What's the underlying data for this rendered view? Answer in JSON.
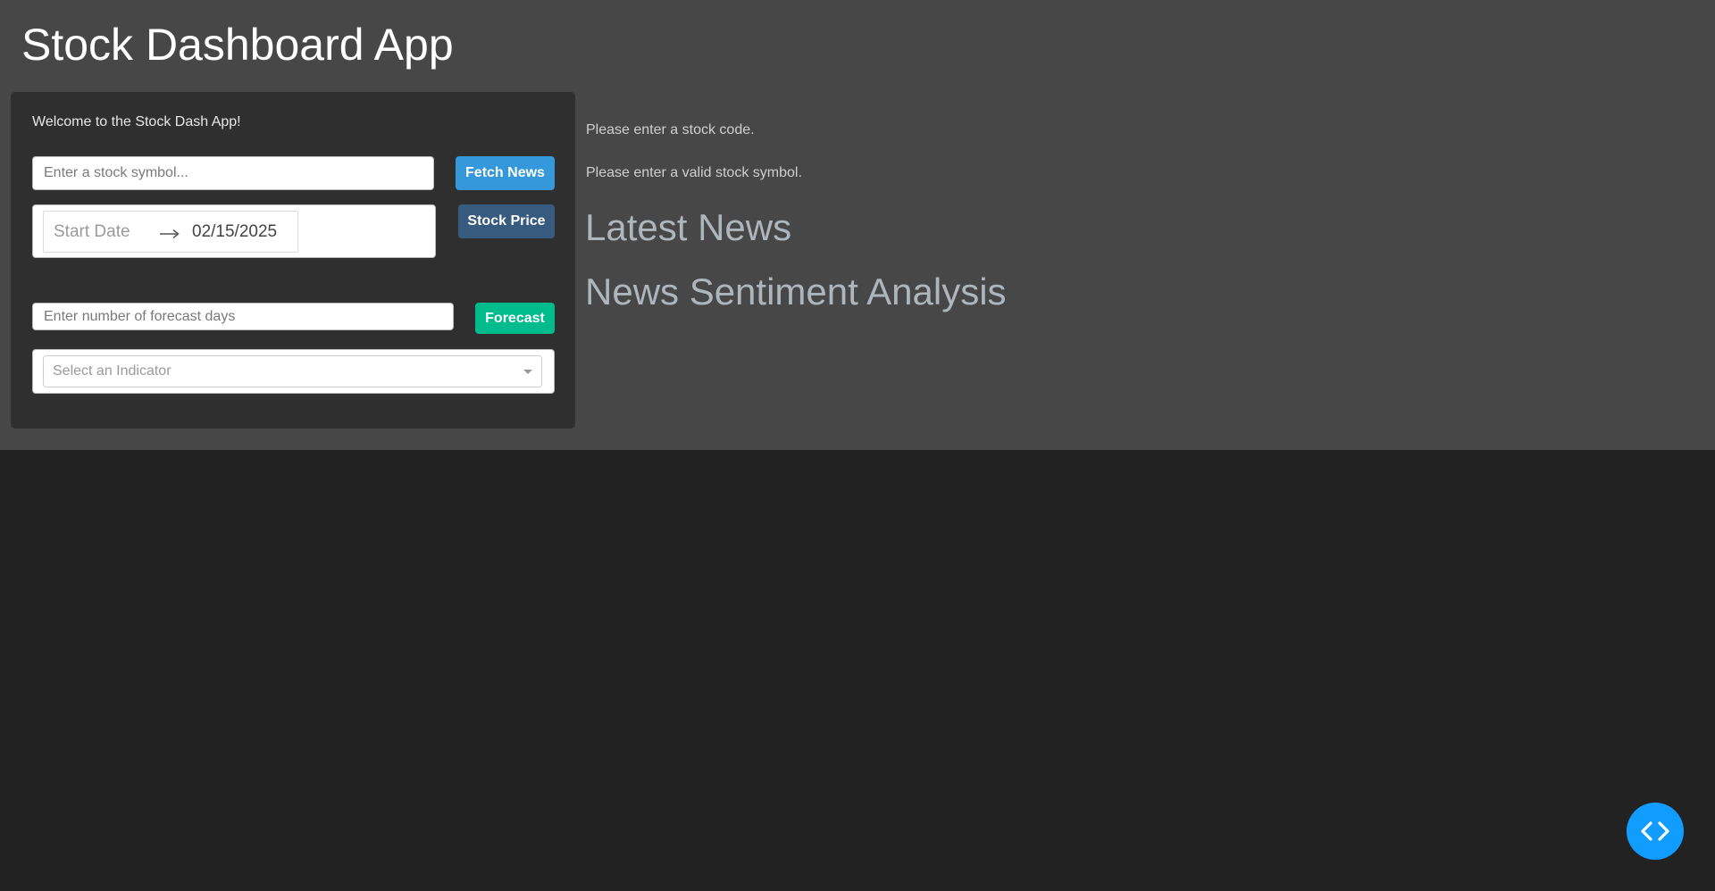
{
  "app": {
    "title": "Stock Dashboard App"
  },
  "panel": {
    "welcome": "Welcome to the Stock Dash App!",
    "symbol_input": {
      "placeholder": "Enter a stock symbol...",
      "value": ""
    },
    "fetch_news_label": "Fetch News",
    "date_range": {
      "start_placeholder": "Start Date",
      "end_value": "02/15/2025"
    },
    "stock_price_label": "Stock Price",
    "forecast_input": {
      "placeholder": "Enter number of forecast days",
      "value": ""
    },
    "forecast_label": "Forecast",
    "indicator_select": {
      "placeholder": "Select an Indicator"
    }
  },
  "main": {
    "messages": [
      "Please enter a stock code.",
      "Please enter a valid stock symbol."
    ],
    "latest_news_heading": "Latest News",
    "sentiment_heading": "News Sentiment Analysis"
  },
  "icons": {
    "date_separator": "arrow-right-icon",
    "indicator_dropdown": "caret-down-icon",
    "dev_tools": "code-brackets-icon"
  },
  "colors": {
    "page_background": "#222222",
    "header_background": "#474747",
    "panel_background": "#2f2f2f",
    "fetch_news_button": "#3498db",
    "stock_price_button": "#375a7f",
    "forecast_button": "#00bc8c",
    "dev_tools_button": "#119dff",
    "heading_text": "#adb5bd"
  }
}
